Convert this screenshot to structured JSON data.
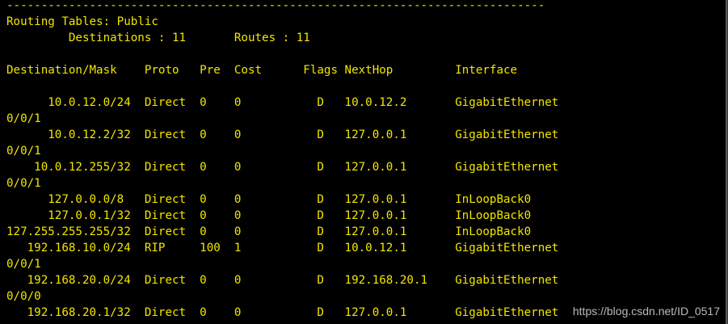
{
  "terminal": {
    "fg_color": "#f2e600",
    "bg_color": "#000000",
    "lines": [
      "------------------------------------------------------------------------------",
      "Routing Tables: Public",
      "         Destinations : 11       Routes : 11",
      "",
      "Destination/Mask    Proto   Pre  Cost      Flags NextHop         Interface",
      "",
      "      10.0.12.0/24  Direct  0    0           D   10.0.12.2       GigabitEthernet",
      "0/0/1",
      "      10.0.12.2/32  Direct  0    0           D   127.0.0.1       GigabitEthernet",
      "0/0/1",
      "    10.0.12.255/32  Direct  0    0           D   127.0.0.1       GigabitEthernet",
      "0/0/1",
      "      127.0.0.0/8   Direct  0    0           D   127.0.0.1       InLoopBack0",
      "      127.0.0.1/32  Direct  0    0           D   127.0.0.1       InLoopBack0",
      "127.255.255.255/32  Direct  0    0           D   127.0.0.1       InLoopBack0",
      "   192.168.10.0/24  RIP     100  1           D   10.0.12.1       GigabitEthernet",
      "0/0/1",
      "   192.168.20.0/24  Direct  0    0           D   192.168.20.1    GigabitEthernet",
      "0/0/0",
      "   192.168.20.1/32  Direct  0    0           D   127.0.0.1       GigabitEthernet"
    ]
  },
  "watermark": {
    "text": "https://blog.csdn.net/ID_0517"
  }
}
